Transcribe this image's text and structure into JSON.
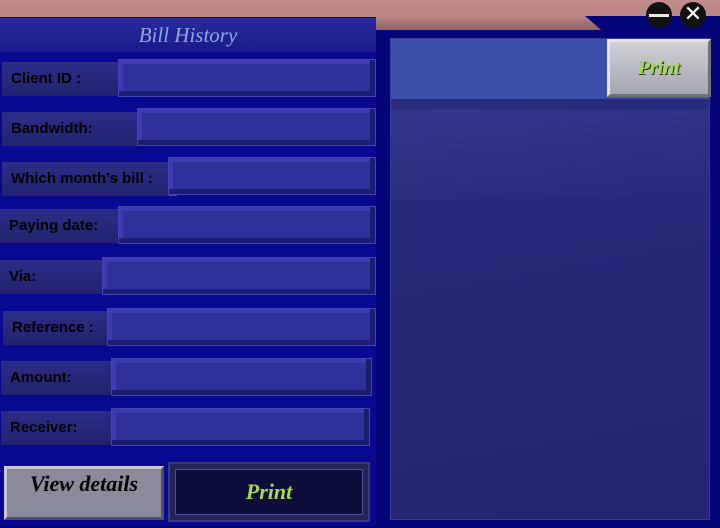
{
  "window": {
    "minimize_icon": "minimize-icon",
    "close_icon": "close-icon",
    "close_glyph": "✕"
  },
  "panel": {
    "title": "Bill History"
  },
  "fields": {
    "client_id": {
      "label": "Client ID :",
      "value": ""
    },
    "bandwidth": {
      "label": "Bandwidth:",
      "value": ""
    },
    "month": {
      "label": "Which month’s bill  :",
      "value": ""
    },
    "paying_date": {
      "label": "Paying date:",
      "value": ""
    },
    "via": {
      "label": "Via:",
      "value": ""
    },
    "reference": {
      "label": "Reference :",
      "value": ""
    },
    "amount": {
      "label": "Amount:",
      "value": ""
    },
    "receiver": {
      "label": "Receiver:",
      "value": ""
    }
  },
  "buttons": {
    "view_details": "View details",
    "print": "Print",
    "print_top": "Print"
  },
  "colors": {
    "background": "#05057a",
    "titlebar": "#c48c8c",
    "print_text": "#a4d84c",
    "title_text": "#8fa8e0"
  }
}
